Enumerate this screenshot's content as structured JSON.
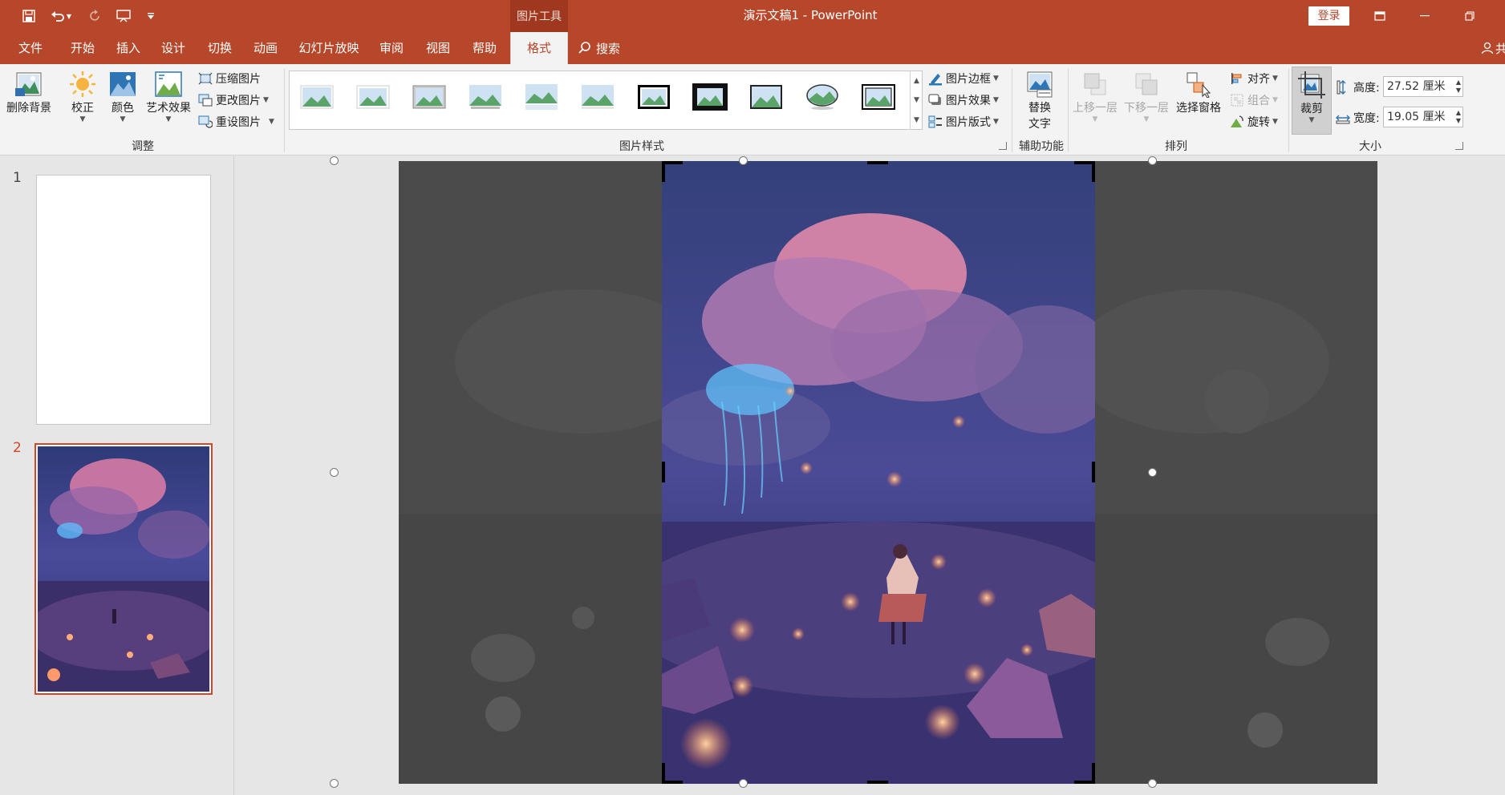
{
  "window": {
    "title": "演示文稿1  -  PowerPoint",
    "context_tab_group": "图片工具",
    "login_label": "登录"
  },
  "tabs": [
    "文件",
    "开始",
    "插入",
    "设计",
    "切换",
    "动画",
    "幻灯片放映",
    "审阅",
    "视图",
    "帮助",
    "格式"
  ],
  "active_tab": "格式",
  "search_label": "搜索",
  "share_label": "共",
  "ribbon": {
    "adjust": {
      "remove_bg": "删除背景",
      "corrections": "校正",
      "color": "颜色",
      "artistic": "艺术效果",
      "compress": "压缩图片",
      "change": "更改图片",
      "reset": "重设图片",
      "group_label": "调整"
    },
    "styles": {
      "border": "图片边框",
      "effects": "图片效果",
      "layout": "图片版式",
      "group_label": "图片样式"
    },
    "accessibility": {
      "alt_text_line1": "替换",
      "alt_text_line2": "文字",
      "group_label": "辅助功能"
    },
    "arrange": {
      "bring_forward": "上移一层",
      "send_backward": "下移一层",
      "selection_pane": "选择窗格",
      "align": "对齐",
      "group": "组合",
      "rotate": "旋转",
      "group_label": "排列"
    },
    "size": {
      "crop": "裁剪",
      "height_label": "高度:",
      "height_value": "27.52 厘米",
      "width_label": "宽度:",
      "width_value": "19.05 厘米",
      "group_label": "大小"
    }
  },
  "slides": [
    {
      "number": "1"
    },
    {
      "number": "2"
    }
  ],
  "colors": {
    "accent": "#b7472a",
    "selected_thumb_border": "#d24726",
    "crop_outside": "#4d4d4d"
  },
  "icons": [
    "save-icon",
    "undo-icon",
    "redo-icon",
    "present-icon",
    "customize-icon",
    "search-icon",
    "person-icon"
  ]
}
